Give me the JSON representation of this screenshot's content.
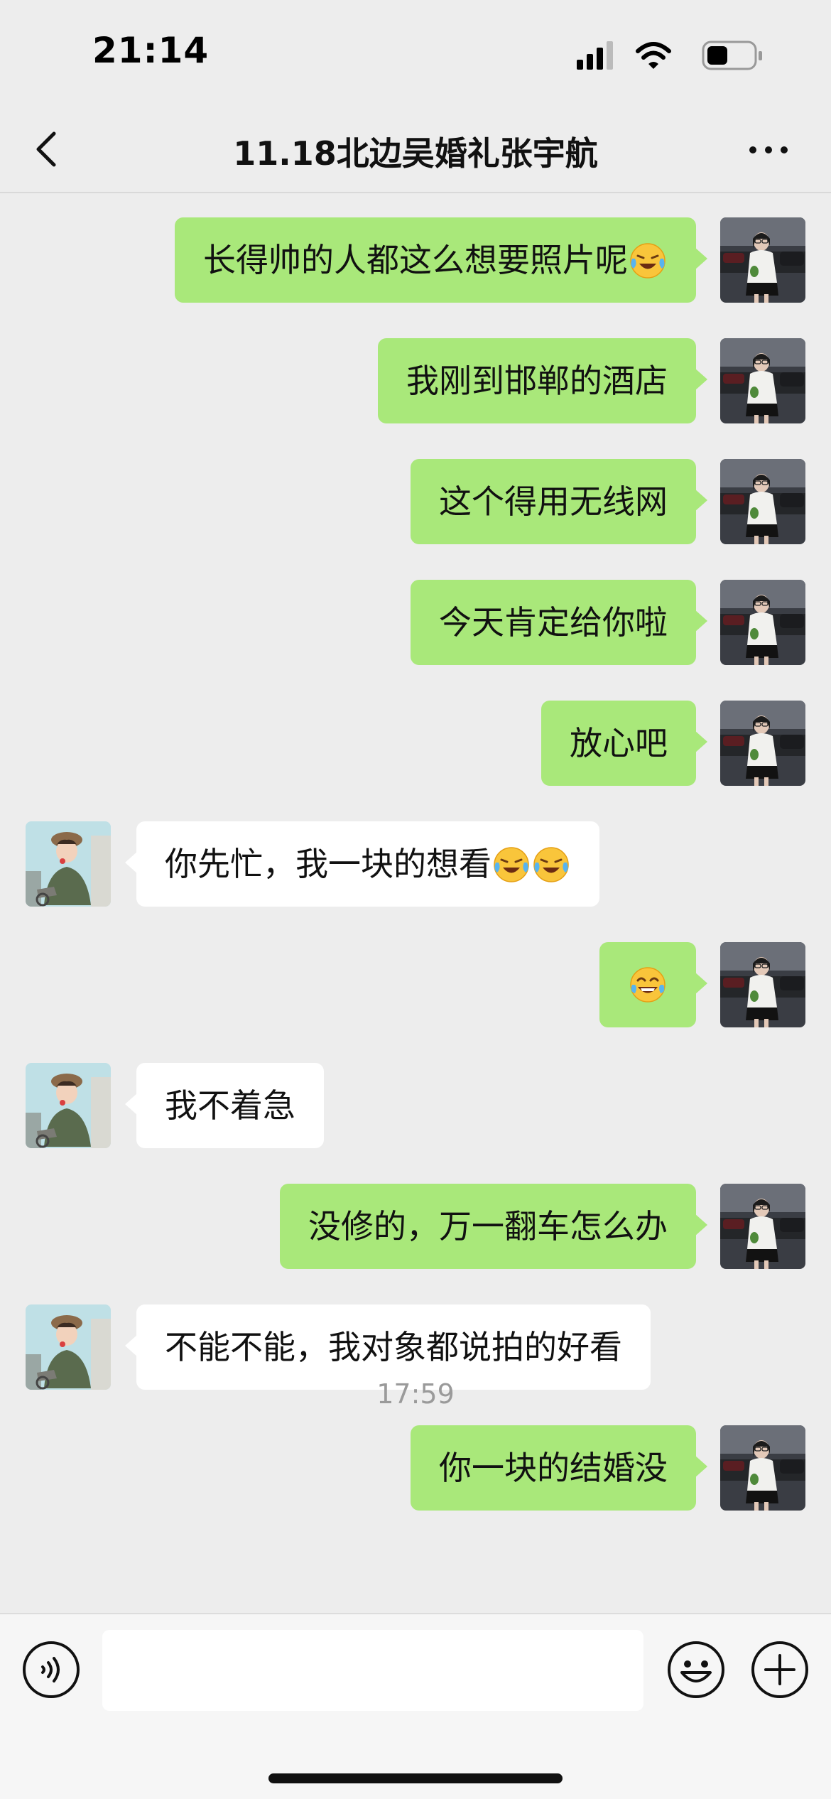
{
  "status_bar": {
    "time": "21:14"
  },
  "nav": {
    "title": "11.18北边吴婚礼张宇航",
    "back_icon": "chevron-left-icon",
    "more_icon": "more-horizontal-icon"
  },
  "messages": [
    {
      "direction": "out",
      "text": "长得帅的人都这么想要照片呢",
      "emojis": [
        "tears-of-joy-emoji"
      ]
    },
    {
      "direction": "out",
      "text": "我刚到邯郸的酒店",
      "emojis": []
    },
    {
      "direction": "out",
      "text": "这个得用无线网",
      "emojis": []
    },
    {
      "direction": "out",
      "text": "今天肯定给你啦",
      "emojis": []
    },
    {
      "direction": "out",
      "text": "放心吧",
      "emojis": []
    },
    {
      "direction": "in",
      "text": "你先忙，我一块的想看",
      "emojis": [
        "tears-of-joy-emoji",
        "tears-of-joy-emoji"
      ]
    },
    {
      "direction": "out",
      "text": "",
      "emojis": [
        "joy-emoji"
      ]
    },
    {
      "direction": "in",
      "text": "我不着急",
      "emojis": []
    },
    {
      "direction": "out",
      "text": "没修的，万一翻车怎么办",
      "emojis": []
    },
    {
      "direction": "in",
      "text": "不能不能，我对象都说拍的好看",
      "emojis": []
    },
    {
      "direction": "out",
      "text": "你一块的结婚没",
      "emojis": []
    }
  ],
  "timestamp": "17:59",
  "input_bar": {
    "value": "",
    "voice_icon": "voice-icon",
    "emoji_icon": "emoji-face-icon",
    "plus_icon": "plus-circle-icon"
  },
  "colors": {
    "background": "#ededed",
    "outgoing_bubble": "#a9e87a",
    "incoming_bubble": "#ffffff",
    "timestamp": "#9a9a9a"
  }
}
